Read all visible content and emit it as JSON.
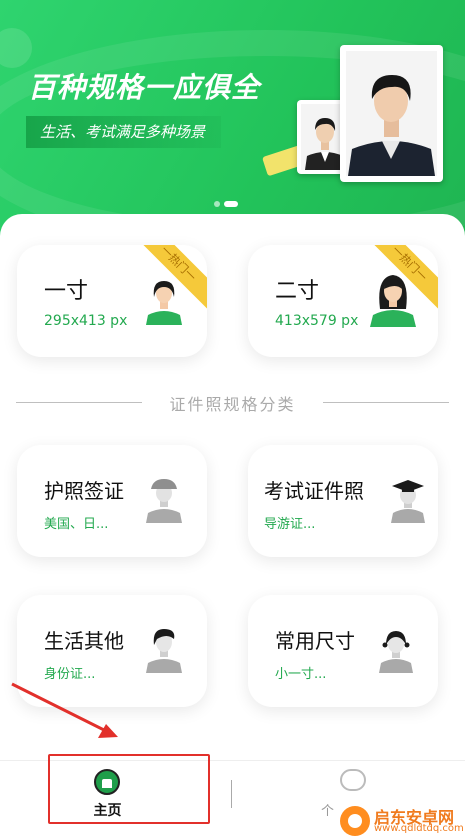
{
  "banner": {
    "title": "百种规格一应俱全",
    "tagline": "生活、考试满足多种场景",
    "page_indicator": {
      "count": 2,
      "active": 1
    }
  },
  "hot_cards": [
    {
      "title": "一寸",
      "size": "295x413 px",
      "badge": "一热门一"
    },
    {
      "title": "二寸",
      "size": "413x579 px",
      "badge": "一热门一"
    }
  ],
  "section_title": "证件照规格分类",
  "categories": [
    {
      "title": "护照签证",
      "sub": "美国、日..."
    },
    {
      "title": "考试证件照",
      "sub": "导游证..."
    },
    {
      "title": "生活其他",
      "sub": "身份证..."
    },
    {
      "title": "常用尺寸",
      "sub": "小一寸..."
    }
  ],
  "tabbar": {
    "home_label": "主页",
    "me_label": "个"
  },
  "watermark": {
    "title": "启东安卓网",
    "url": "www.qdldtdq.com"
  },
  "colors": {
    "brand_green": "#22c35a",
    "accent_text": "#23a94f",
    "badge": "#f5c93a",
    "highlight": "#e2302b"
  }
}
